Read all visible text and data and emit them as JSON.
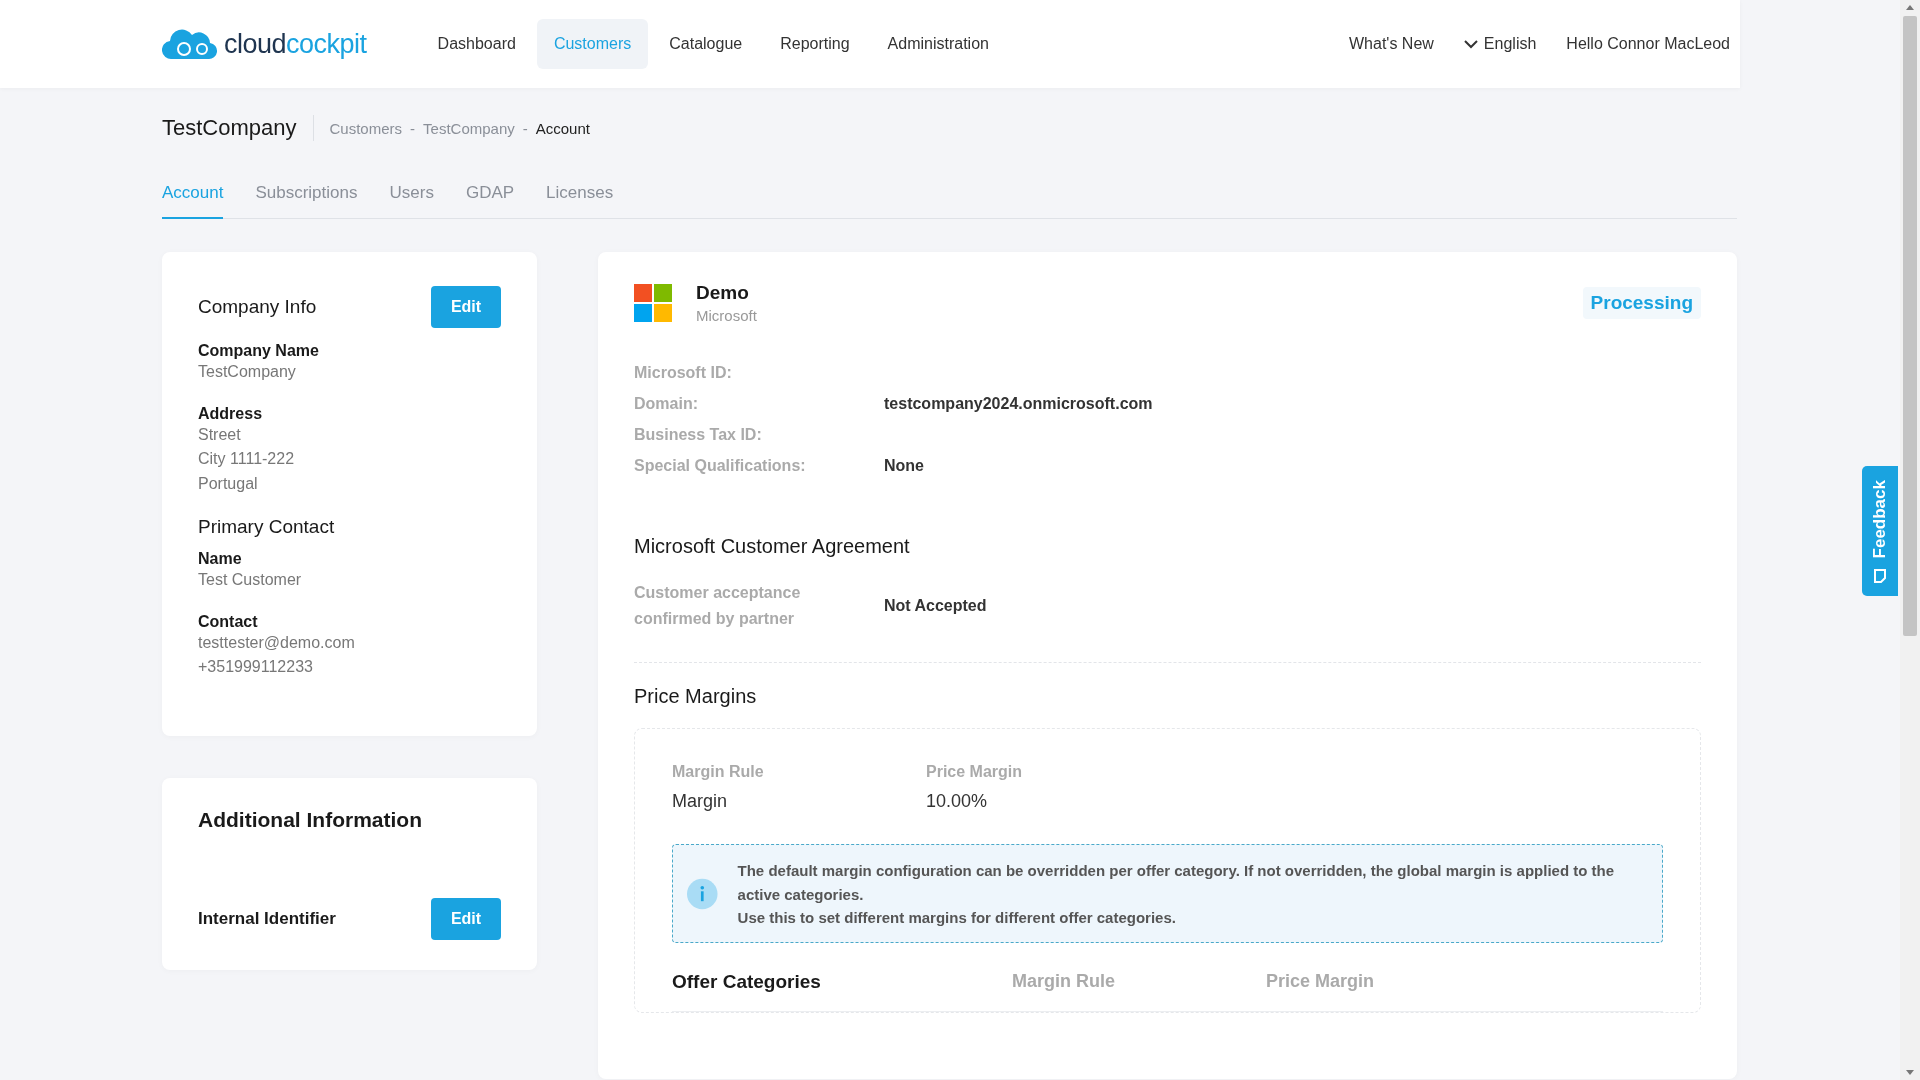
{
  "header": {
    "logo": [
      "cloud",
      "cockpit"
    ],
    "nav": [
      {
        "label": "Dashboard",
        "selected": false
      },
      {
        "label": "Customers",
        "selected": true
      },
      {
        "label": "Catalogue",
        "selected": false
      },
      {
        "label": "Reporting",
        "selected": false
      },
      {
        "label": "Administration",
        "selected": false
      }
    ],
    "whats_new": "What's New",
    "language": "English",
    "greeting": "Hello Connor MacLeod"
  },
  "page": {
    "title": "TestCompany",
    "breadcrumb_separator": "-",
    "breadcrumb": [
      "Customers",
      "TestCompany",
      "Account"
    ]
  },
  "tabs": [
    {
      "label": "Account",
      "selected": true
    },
    {
      "label": "Subscriptions",
      "selected": false
    },
    {
      "label": "Users",
      "selected": false
    },
    {
      "label": "GDAP",
      "selected": false
    },
    {
      "label": "Licenses",
      "selected": false
    }
  ],
  "company_info": {
    "title": "Company Info",
    "edit_button": "Edit",
    "fields": [
      {
        "label": "Company Name",
        "lines": [
          "TestCompany"
        ]
      },
      {
        "label": "Address",
        "lines": [
          "Street",
          "City 1111-222",
          "Portugal"
        ]
      }
    ],
    "primary_contact": {
      "title": "Primary Contact",
      "fields": [
        {
          "label": "Name",
          "lines": [
            "Test Customer"
          ]
        },
        {
          "label": "Contact",
          "lines": [
            "testtester@demo.com",
            "+351999112233"
          ]
        }
      ]
    }
  },
  "additional_info": {
    "title": "Additional Information",
    "label": "Internal Identifier",
    "edit_button": "Edit"
  },
  "subscription": {
    "name": "Demo",
    "vendor": "Microsoft",
    "status": "Processing",
    "details": [
      {
        "label": "Microsoft ID:"
      },
      {
        "label": "Domain:",
        "value": "testcompany2024.onmicrosoft.com"
      },
      {
        "label": "Business Tax ID:"
      },
      {
        "label": "Special Qualifications:",
        "value": "None"
      }
    ]
  },
  "agreement": {
    "title": "Microsoft Customer Agreement",
    "label": "Customer acceptance confirmed by partner",
    "value": "Not Accepted"
  },
  "price_margins": {
    "title": "Price Margins",
    "columns": [
      {
        "label": "Margin Rule",
        "value": "Margin"
      },
      {
        "label": "Price Margin",
        "value": "10.00%"
      }
    ],
    "info": [
      "The default margin configuration can be overridden per offer category. If not overridden, the global margin is applied to the active categories.",
      "Use this to set different margins for different offer categories."
    ],
    "offer_categories": {
      "title": "Offer Categories",
      "columns": [
        "Margin Rule",
        "Price Margin"
      ]
    }
  },
  "feedback": "Feedback"
}
